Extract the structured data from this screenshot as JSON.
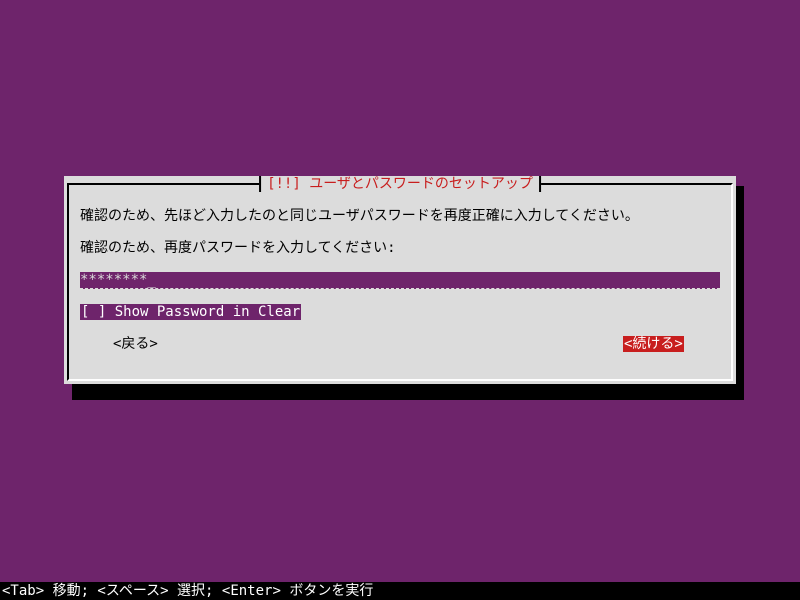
{
  "dialog": {
    "title": "[!!] ユーザとパスワードのセットアップ",
    "message": "確認のため、先ほど入力したのと同じユーザパスワードを再度正確に入力してください。",
    "prompt": "確認のため、再度パスワードを入力してください:",
    "password_value": "********_",
    "show_password_label": "[ ] Show Password in Clear",
    "back_label": "<戻る>",
    "continue_label": "<続ける>"
  },
  "statusbar": {
    "help_text": "<Tab> 移動; <スペース> 選択; <Enter> ボタンを実行"
  },
  "colors": {
    "background": "#6e246b",
    "dialog": "#dcdcdc",
    "title_text": "#c81e1e",
    "selected_button": "#c81e1e"
  }
}
